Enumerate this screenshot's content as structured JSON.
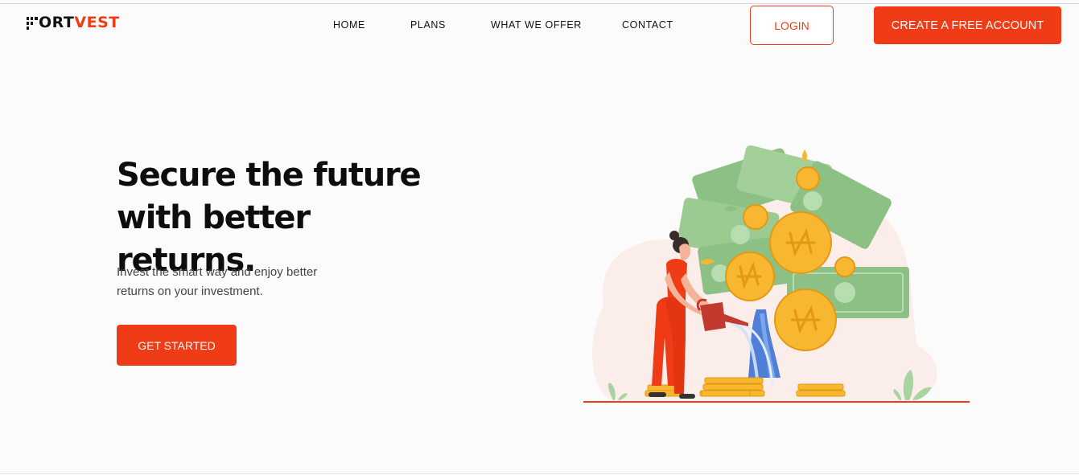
{
  "header": {
    "logo": {
      "prefix": "F",
      "main": "ORT",
      "accent": "VEST"
    },
    "nav": [
      {
        "label": "HOME"
      },
      {
        "label": "PLANS"
      },
      {
        "label": "WHAT WE OFFER"
      },
      {
        "label": "CONTACT"
      }
    ],
    "login_label": "LOGIN",
    "create_account_label": "CREATE A FREE ACCOUNT"
  },
  "hero": {
    "title_line1": "Secure the future",
    "title_line2": "with better returns.",
    "subtitle_line1": "Invest the smart way and enjoy better",
    "subtitle_line2": "returns on your investment.",
    "cta_label": "GET STARTED"
  },
  "illustration": {
    "icon": "money-tree-illustration",
    "currency_symbol": "₦"
  },
  "colors": {
    "brand": "#f03c16",
    "background": "#fbfbfb",
    "text": "#111111",
    "money_green": "#8cc084",
    "coin_gold": "#f7b731"
  }
}
